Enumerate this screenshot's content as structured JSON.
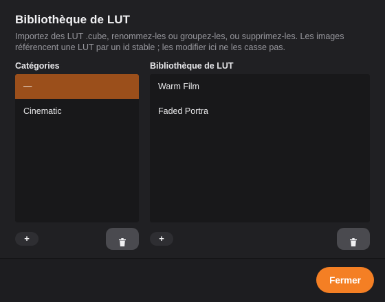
{
  "dialog": {
    "title": "Bibliothèque de LUT",
    "description": "Importez des LUT .cube, renommez-les ou groupez-les, ou supprimez-les. Les images référencent une LUT par un id stable ; les modifier ici ne les casse pas."
  },
  "categories": {
    "label": "Catégories",
    "items": [
      {
        "label": "—",
        "selected": true
      },
      {
        "label": "Cinematic",
        "selected": false
      }
    ],
    "add_label": "+",
    "delete_icon": "trash-icon"
  },
  "library": {
    "label": "Bibliothèque de LUT",
    "items": [
      {
        "label": "Warm Film"
      },
      {
        "label": "Faded Portra"
      }
    ],
    "add_label": "+",
    "delete_icon": "trash-icon"
  },
  "footer": {
    "close_label": "Fermer"
  },
  "colors": {
    "accent": "#f47f24",
    "selected_row": "#9b4f1b",
    "dialog_bg": "#202023",
    "panel_bg": "#18181a"
  }
}
